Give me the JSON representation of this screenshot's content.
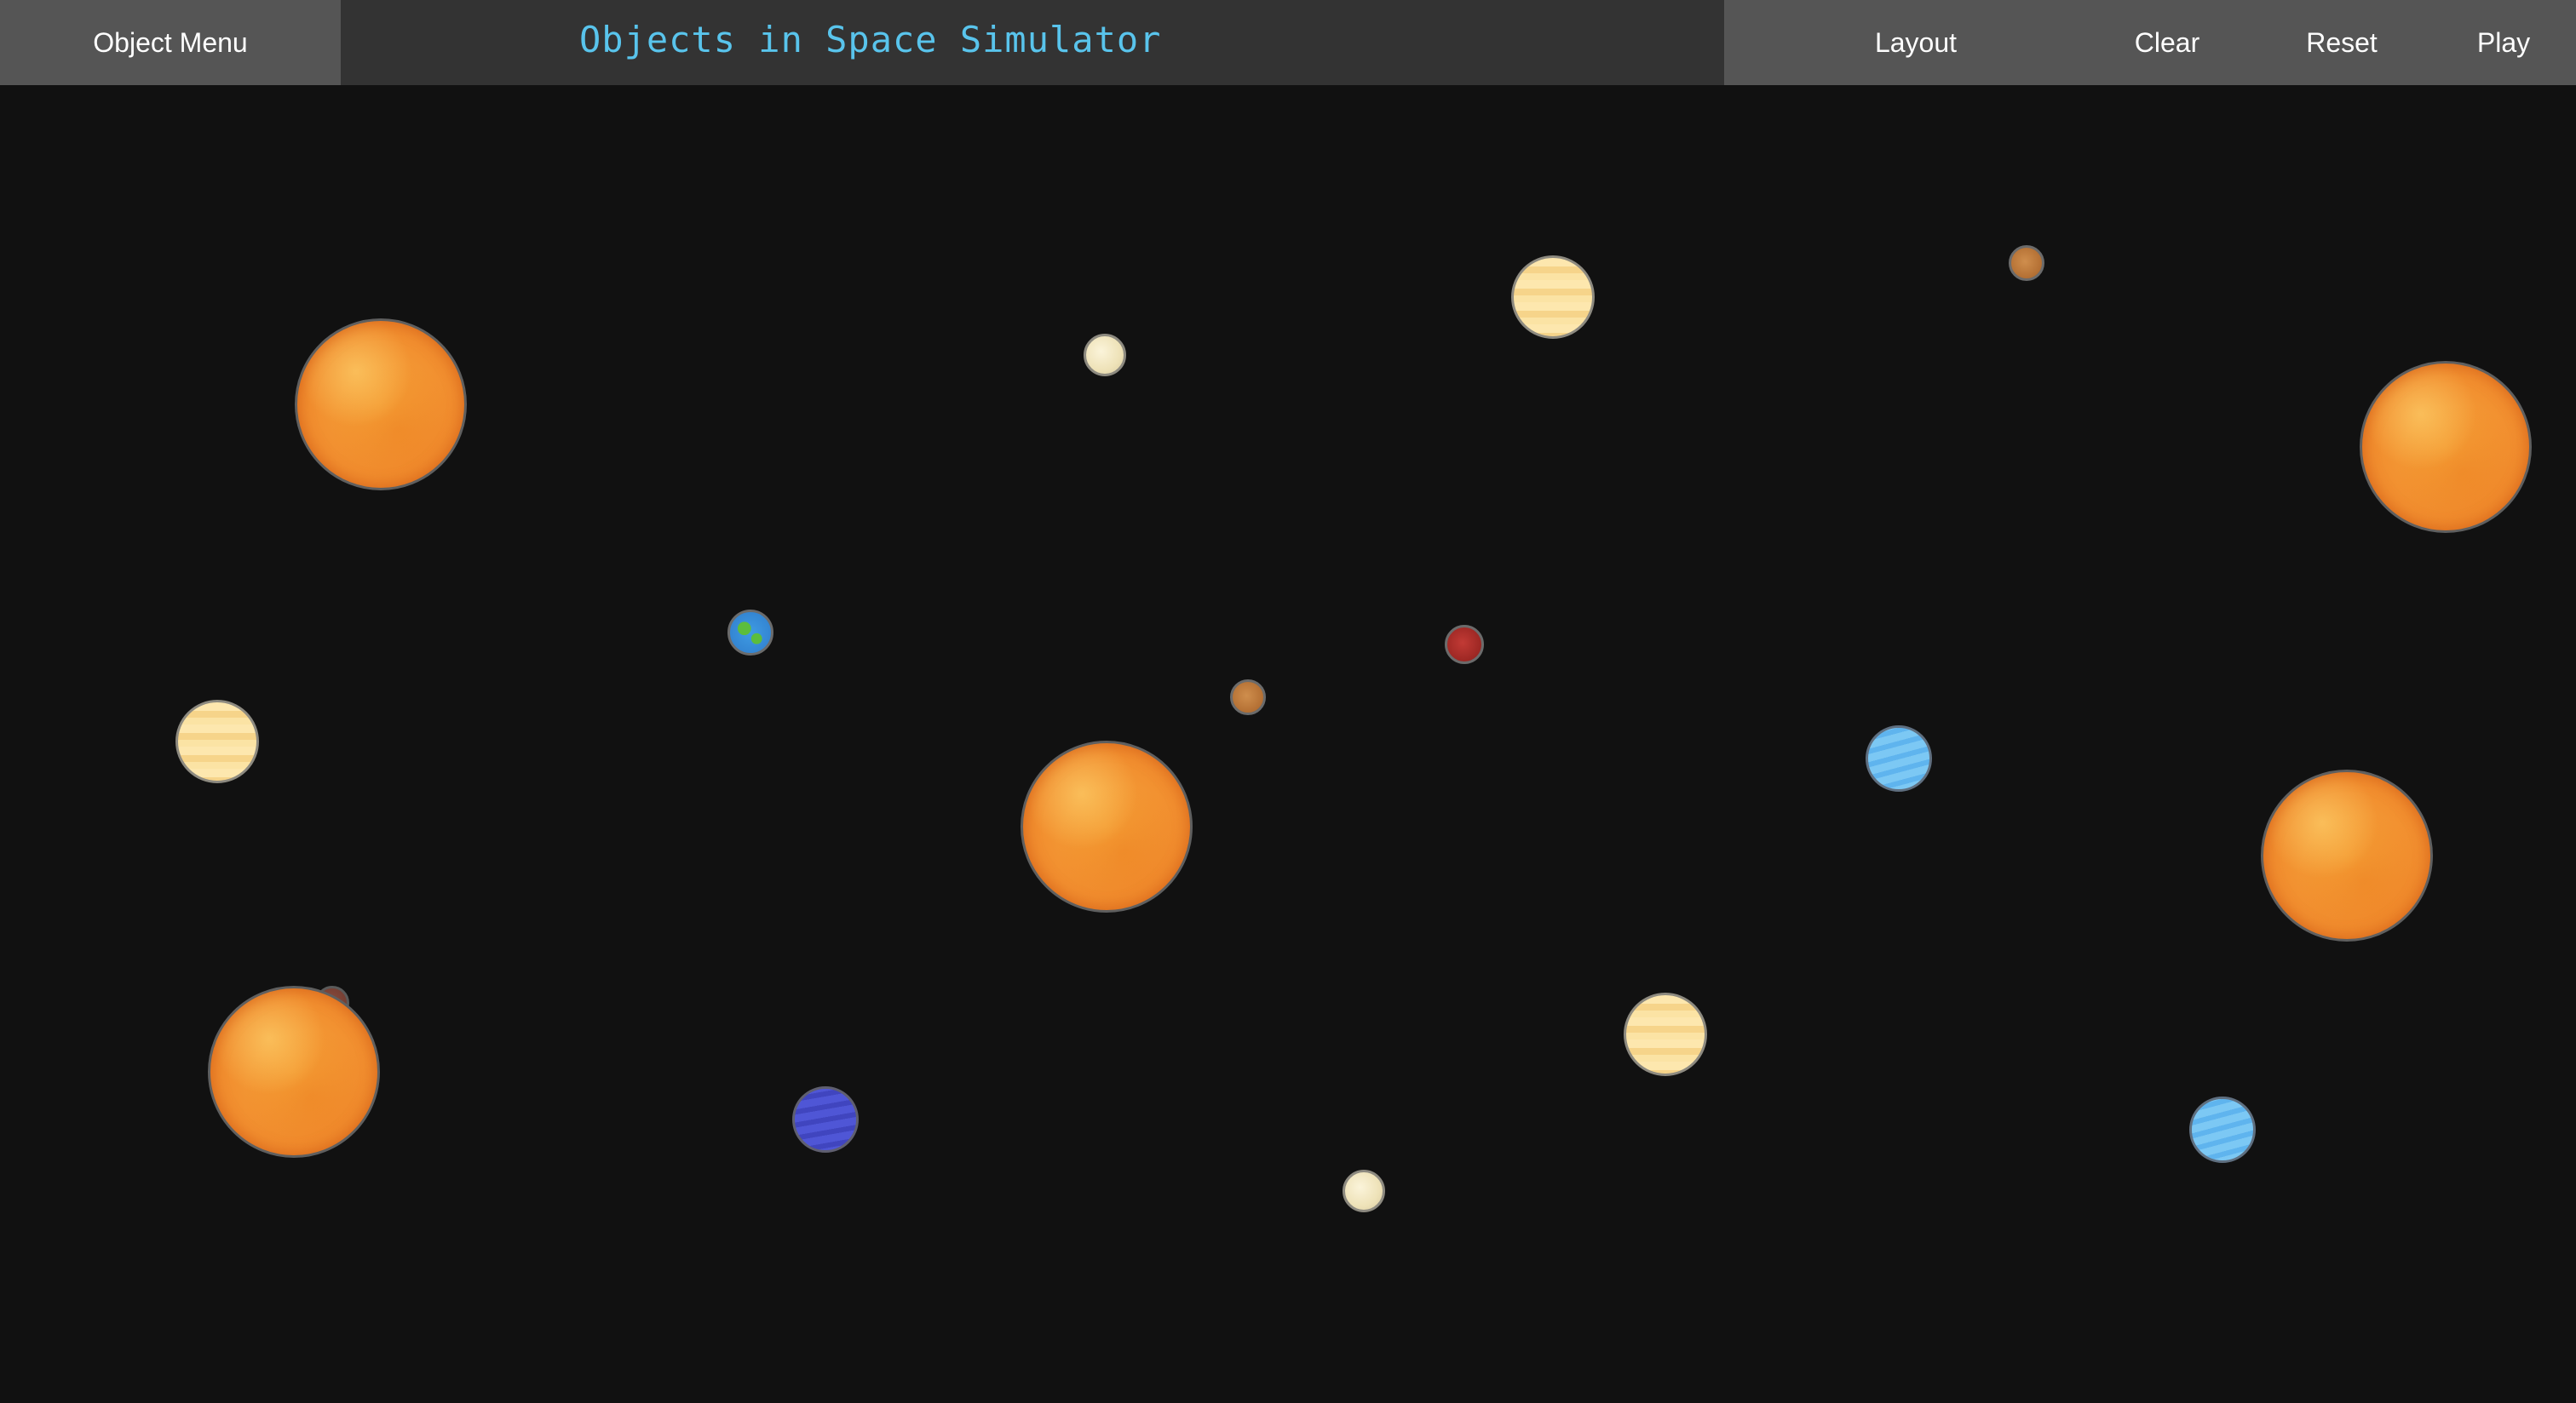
{
  "header": {
    "menu_label": "Object Menu",
    "title": "Objects in Space Simulator",
    "controls": {
      "layout_label": "Layout",
      "clear_label": "Clear",
      "reset_label": "Reset",
      "play_label": "Play"
    }
  },
  "colors": {
    "title": "#59c4ec",
    "background": "#111111",
    "header_button": "#555555",
    "header_center": "#333333",
    "sun": "#f18e2f",
    "gas_giant": "#fbe3a4",
    "moon": "#eee2b8",
    "rocky": "#b36f33",
    "red_planet": "#9c2723",
    "earth_like": "#3f9be3",
    "ice_giant": "#6cbdf1",
    "neptune_like": "#4a50cf"
  }
}
